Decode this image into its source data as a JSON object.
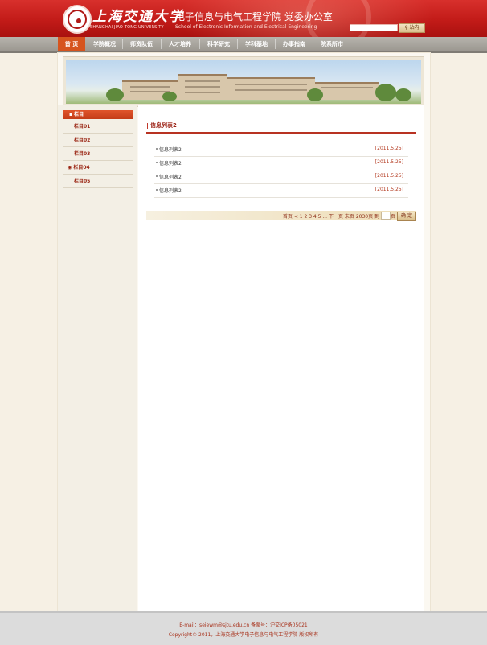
{
  "header": {
    "university_cn": "上海交通大学",
    "university_en": "SHANGHAI JIAO TONG UNIVERSITY",
    "school_cn": "电子信息与电气工程学院   党委办公室",
    "school_en": "School of Electronic Information and Electrical Engineering",
    "search_placeholder": "",
    "search_button": "站内"
  },
  "nav": {
    "items": [
      "首 页",
      "学院概况",
      "师资队伍",
      "人才培养",
      "科学研究",
      "学科基地",
      "办事指南",
      "院系所市"
    ]
  },
  "sidebar": {
    "heading": "栏目",
    "items": [
      "栏目01",
      "栏目02",
      "栏目03",
      "栏目04",
      "栏目05"
    ]
  },
  "main": {
    "title": "信息列表2",
    "rows": [
      {
        "title": "信息列表2",
        "date": "[2011.5.25]"
      },
      {
        "title": "信息列表2",
        "date": "[2011.5.25]"
      },
      {
        "title": "信息列表2",
        "date": "[2011.5.25]"
      },
      {
        "title": "信息列表2",
        "date": "[2011.5.25]"
      }
    ]
  },
  "pager": {
    "text": "首页 < 1 2 3 4 5 ... 下一页 末页 2030页 到",
    "unit": "页",
    "button": "确 定"
  },
  "footer": {
    "line1": "E-mail：seiewm@sjtu.edu.cn 备案号：沪交ICP备05021",
    "line2": "Copyright© 2011，上海交通大学电子信息与电气工程学院 版权所有"
  }
}
